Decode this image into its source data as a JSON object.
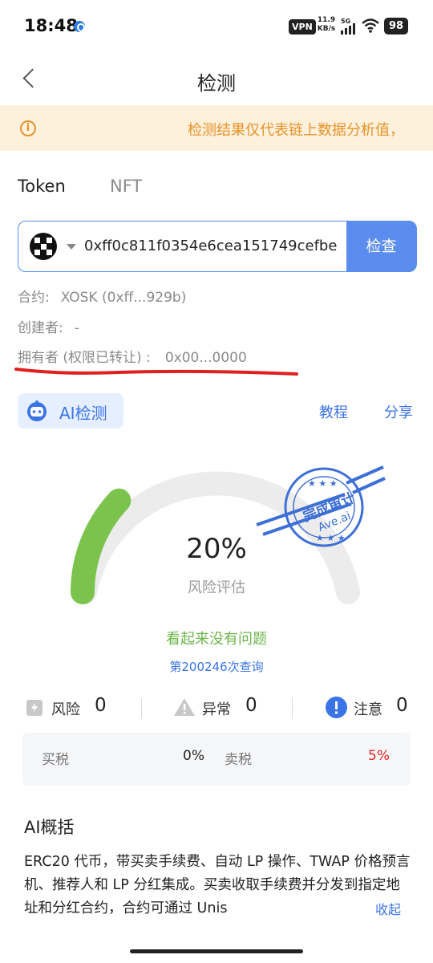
{
  "status_bar": {
    "time": "18:48",
    "vpn": "VPN",
    "net_speed": "11.9",
    "net_unit": "KB/s",
    "network": "5G",
    "battery": "98"
  },
  "header": {
    "title": "检测"
  },
  "notice": {
    "text": "检测结果仅代表链上数据分析值，"
  },
  "tabs": [
    {
      "label": "Token",
      "active": true
    },
    {
      "label": "NFT",
      "active": false
    }
  ],
  "search": {
    "value": "0xff0c811f0354e6cea151749cefbe",
    "button": "检查"
  },
  "info": {
    "contract_label": "合约:",
    "contract_value": "XOSK (0xff...929b)",
    "creator_label": "创建者:",
    "creator_value": "-",
    "owner_label": "拥有者 (权限已转让) :",
    "owner_value": "0x00...0000"
  },
  "ai": {
    "label": "AI检测",
    "tutorial": "教程",
    "share": "分享"
  },
  "gauge": {
    "percent": "20%",
    "risk_fraction": 0.2,
    "subtitle": "风险评估",
    "status": "看起来没有问题",
    "query_count": "第200246次查询",
    "stamp_title": "完成审计",
    "stamp_brand": "Ave.ai"
  },
  "stats": {
    "risk_label": "风险",
    "risk_value": "0",
    "abnormal_label": "异常",
    "abnormal_value": "0",
    "notice_label": "注意",
    "notice_value": "0"
  },
  "tax": {
    "buy_label": "买税",
    "buy_value": "0%",
    "sell_label": "卖税",
    "sell_value": "5%"
  },
  "summary": {
    "title": "AI概括",
    "text": "ERC20 代币，带买卖手续费、自动 LP 操作、TWAP 价格预言机、推荐人和 LP 分红集成。买卖收取手续费并分发到指定地址和分红合约，合约可通过 Unis",
    "collapse": "收起"
  },
  "colors": {
    "accent": "#3b74e6",
    "warning": "#e8922a",
    "gauge_fill": "#7cc34e",
    "sell_tax": "#e02424"
  }
}
